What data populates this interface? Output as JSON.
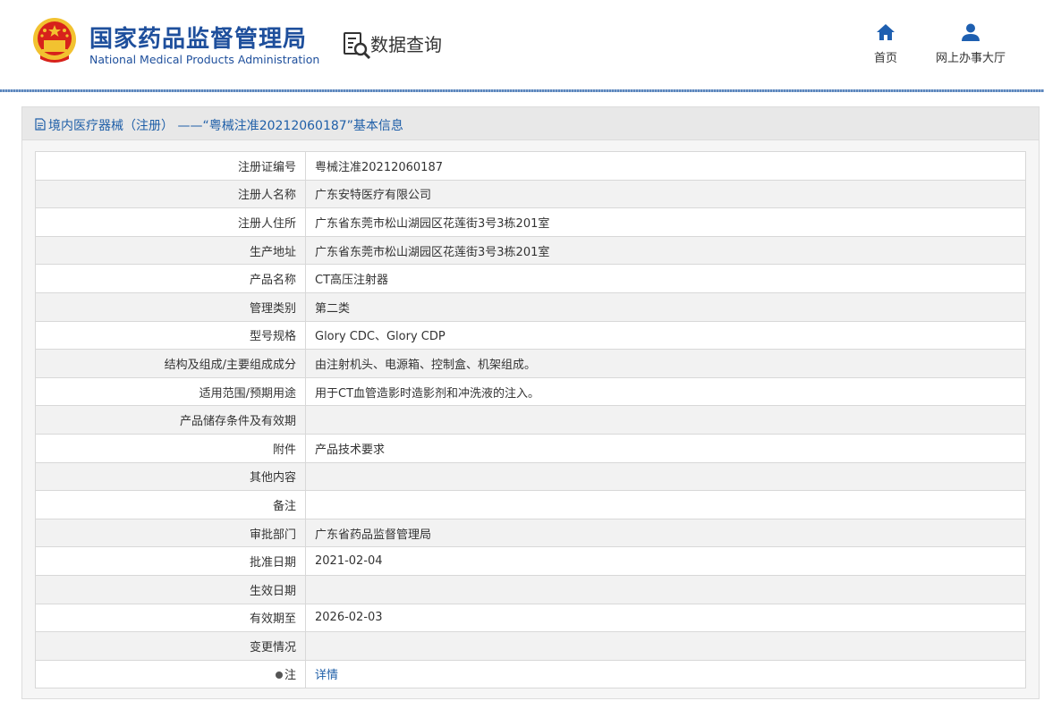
{
  "header": {
    "site_name_cn": "国家药品监督管理局",
    "site_name_en": "National Medical Products Administration",
    "query_label": "数据查询",
    "nav": [
      {
        "label": "首页",
        "icon": "home-icon"
      },
      {
        "label": "网上办事大厅",
        "icon": "user-icon"
      }
    ]
  },
  "panel": {
    "title": "境内医疗器械（注册） ——“粤械注准20212060187”基本信息"
  },
  "rows": [
    {
      "label": "注册证编号",
      "value": "粤械注准20212060187"
    },
    {
      "label": "注册人名称",
      "value": "广东安特医疗有限公司"
    },
    {
      "label": "注册人住所",
      "value": "广东省东莞市松山湖园区花莲街3号3栋201室"
    },
    {
      "label": "生产地址",
      "value": "广东省东莞市松山湖园区花莲街3号3栋201室"
    },
    {
      "label": "产品名称",
      "value": "CT高压注射器"
    },
    {
      "label": "管理类别",
      "value": "第二类"
    },
    {
      "label": "型号规格",
      "value": "Glory CDC、Glory CDP"
    },
    {
      "label": "结构及组成/主要组成成分",
      "value": "由注射机头、电源箱、控制盒、机架组成。"
    },
    {
      "label": "适用范围/预期用途",
      "value": "用于CT血管造影时造影剂和冲洗液的注入。"
    },
    {
      "label": "产品储存条件及有效期",
      "value": ""
    },
    {
      "label": "附件",
      "value": "产品技术要求"
    },
    {
      "label": "其他内容",
      "value": ""
    },
    {
      "label": "备注",
      "value": ""
    },
    {
      "label": "审批部门",
      "value": "广东省药品监督管理局"
    },
    {
      "label": "批准日期",
      "value": "2021-02-04"
    },
    {
      "label": "生效日期",
      "value": ""
    },
    {
      "label": "有效期至",
      "value": "2026-02-03"
    },
    {
      "label": "变更情况",
      "value": ""
    }
  ],
  "note_row": {
    "label": "注",
    "link": "详情"
  },
  "colors": {
    "brand_blue": "#1e4f9c",
    "link_blue": "#1f5fa8",
    "emblem_red": "#d7221b",
    "emblem_gold": "#f2c230"
  }
}
